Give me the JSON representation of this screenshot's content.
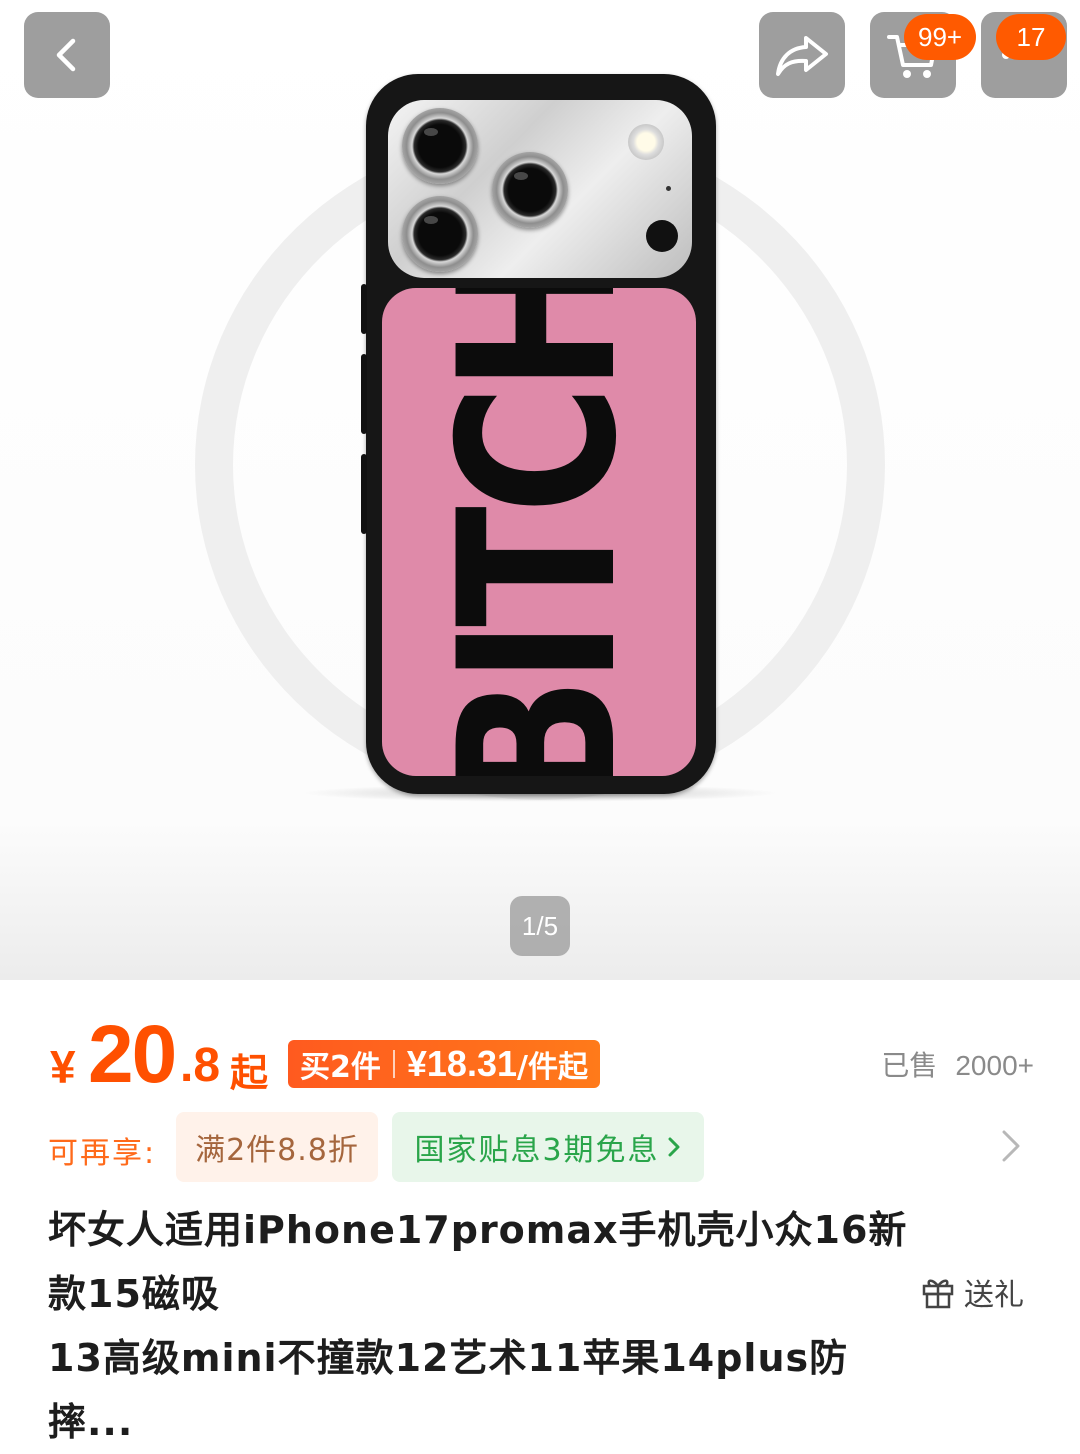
{
  "gallery": {
    "case_print": "BITCH",
    "pager": "1/5"
  },
  "topbar": {
    "cart_badge": "99+",
    "more_badge": "17"
  },
  "price": {
    "currency": "¥",
    "integer": "20",
    "decimal": ".8",
    "suffix": "起",
    "deal_label": "买2件",
    "deal_price": "¥18.31",
    "deal_suffix": "/件起",
    "sold_label": "已售",
    "sold_count": "2000+"
  },
  "promo": {
    "label": "可再享:",
    "discount_chip": "满2件8.8折",
    "installment_chip": "国家贴息3期免息"
  },
  "product": {
    "title_line1": "坏女人适用iPhone17promax手机壳小众16新款15磁吸",
    "title_line2": "13高级mini不撞款12艺术11苹果14plus防摔...",
    "gift_label": "送礼"
  },
  "colors": {
    "accent": "#ff5000",
    "case_pink": "#df8aa9",
    "promo_green": "#2aa54a"
  },
  "icons": [
    "back-icon",
    "share-icon",
    "cart-icon",
    "more-icon",
    "chevron-right-icon",
    "gift-icon"
  ]
}
